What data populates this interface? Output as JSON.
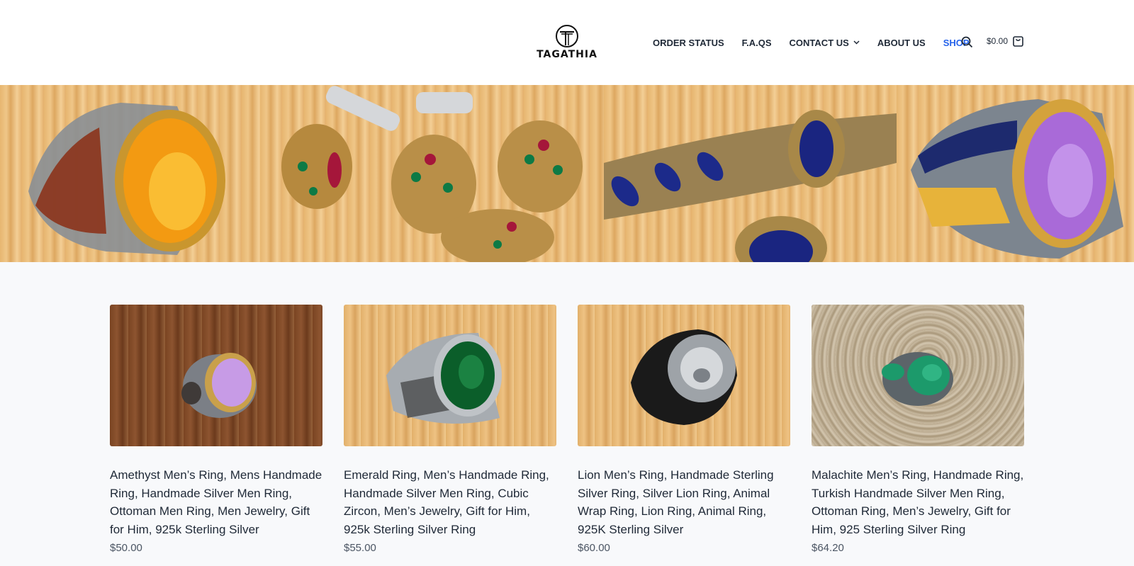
{
  "brand": {
    "logo_text": "TAGATHIA"
  },
  "nav": {
    "items": [
      {
        "label": "ORDER STATUS"
      },
      {
        "label": "F.A.QS"
      },
      {
        "label": "CONTACT US"
      },
      {
        "label": "ABOUT US"
      },
      {
        "label": "SHOP"
      }
    ],
    "active_color": "#2563eb"
  },
  "cart": {
    "total": "$0.00"
  },
  "hero": {
    "panels": [
      {
        "icon": "amber-ring-image"
      },
      {
        "icon": "earrings-image"
      },
      {
        "icon": "sapphire-bracelet-image"
      },
      {
        "icon": "amethyst-ring-image"
      }
    ]
  },
  "products": [
    {
      "title": "Amethyst Men’s Ring, Mens Handmade Ring, Handmade Silver Men Ring, Ottoman Men Ring, Men Jewelry, Gift for Him, 925k Sterling Silver",
      "price": "$50.00"
    },
    {
      "title": "Emerald Ring, Men’s Handmade Ring, Handmade Silver Men Ring, Cubic Zircon, Men’s Jewelry, Gift for Him, 925k Sterling Silver Ring",
      "price": "$55.00"
    },
    {
      "title": "Lion Men’s Ring, Handmade Sterling Silver Ring, Silver Lion Ring, Animal Wrap Ring, Lion Ring, Animal Ring, 925K Sterling Silver",
      "price": "$60.00"
    },
    {
      "title": "Malachite Men’s Ring, Handmade Ring, Turkish Handmade Silver Men Ring, Ottoman Ring, Men’s Jewelry, Gift for Him, 925 Sterling Silver Ring",
      "price": "$64.20"
    }
  ]
}
